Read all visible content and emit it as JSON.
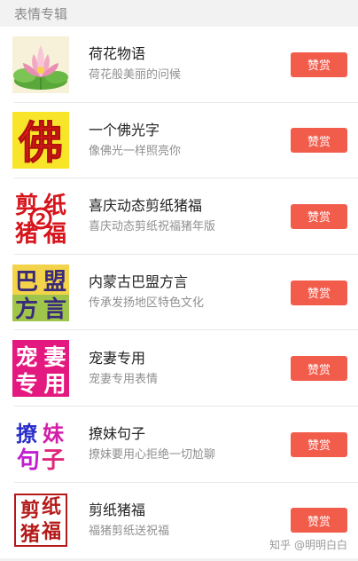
{
  "section": {
    "title": "表情专辑"
  },
  "albums": [
    {
      "title": "荷花物语",
      "desc": "荷花般美丽的问候",
      "button": "赞赏",
      "thumb": "lotus-icon"
    },
    {
      "title": "一个佛光字",
      "desc": "像佛光一样照亮你",
      "button": "赞赏",
      "thumb": "fo-character-icon",
      "thumb_text": "佛"
    },
    {
      "title": "喜庆动态剪纸猪福",
      "desc": "喜庆动态剪纸祝福猪年版",
      "button": "赞赏",
      "thumb": "papercut-pig-2-icon",
      "thumb_text": [
        "剪",
        "纸",
        "猪",
        "福",
        "2"
      ]
    },
    {
      "title": "内蒙古巴盟方言",
      "desc": "传承发扬地区特色文化",
      "button": "赞赏",
      "thumb": "bameng-dialect-icon",
      "thumb_text": [
        "巴",
        "盟",
        "方",
        "言"
      ]
    },
    {
      "title": "宠妻专用",
      "desc": "宠妻专用表情",
      "button": "赞赏",
      "thumb": "pamper-wife-icon",
      "thumb_text": [
        "宠",
        "妻",
        "专",
        "用"
      ]
    },
    {
      "title": "撩妹句子",
      "desc": "撩妹要用心拒绝一切尬聊",
      "button": "赞赏",
      "thumb": "flirt-sentence-icon",
      "thumb_text": [
        "撩",
        "妹",
        "句",
        "子"
      ]
    },
    {
      "title": "剪纸猪福",
      "desc": "福猪剪纸送祝福",
      "button": "赞赏",
      "thumb": "papercut-pig-icon",
      "thumb_text": [
        "剪",
        "纸",
        "猪",
        "福"
      ]
    }
  ],
  "watermark": "知乎 @明明白白",
  "colors": {
    "button_bg": "#f25c4b",
    "header_bg": "#f2f2f2",
    "list_bg": "#ffffff"
  }
}
